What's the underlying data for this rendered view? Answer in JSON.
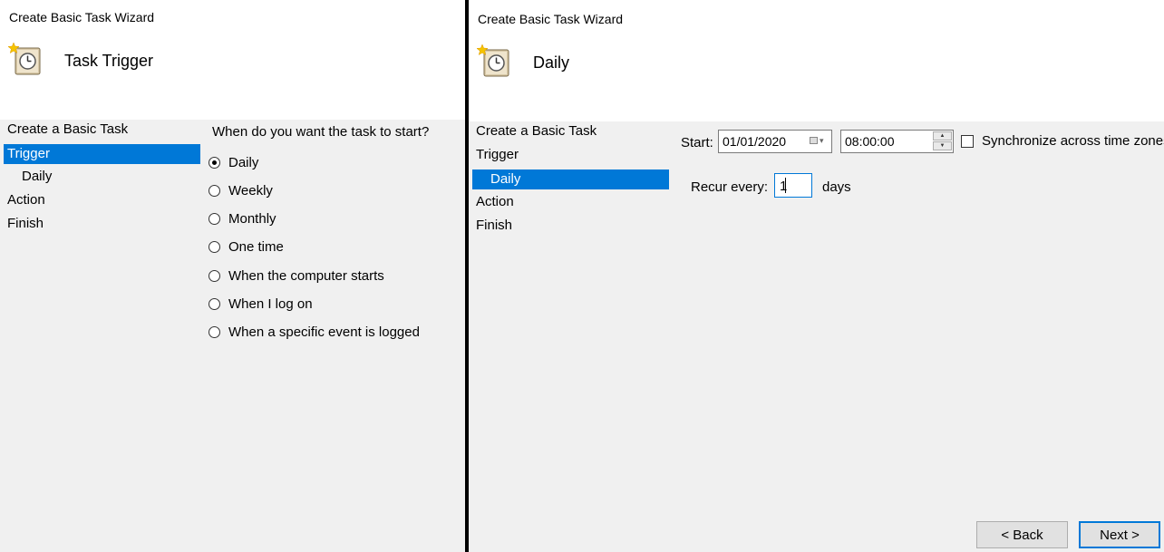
{
  "left_window": {
    "title": "Create Basic Task Wizard",
    "page_title": "Task Trigger",
    "icon": "scheduler-clock-icon",
    "nav": [
      {
        "label": "Create a Basic Task",
        "selected": false
      },
      {
        "label": "Trigger",
        "selected": true
      },
      {
        "label": "Daily",
        "selected": false,
        "sub": true
      },
      {
        "label": "Action",
        "selected": false
      },
      {
        "label": "Finish",
        "selected": false
      }
    ],
    "question": "When do you want the task to start?",
    "options": [
      {
        "label": "Daily",
        "checked": true
      },
      {
        "label": "Weekly",
        "checked": false
      },
      {
        "label": "Monthly",
        "checked": false
      },
      {
        "label": "One time",
        "checked": false
      },
      {
        "label": "When the computer starts",
        "checked": false
      },
      {
        "label": "When I log on",
        "checked": false
      },
      {
        "label": "When a specific event is logged",
        "checked": false
      }
    ]
  },
  "right_window": {
    "title": "Create Basic Task Wizard",
    "page_title": "Daily",
    "icon": "scheduler-clock-icon",
    "nav": [
      {
        "label": "Create a Basic Task",
        "selected": false
      },
      {
        "label": "Trigger",
        "selected": false
      },
      {
        "label": "Daily",
        "selected": true,
        "sub": true
      },
      {
        "label": "Action",
        "selected": false
      },
      {
        "label": "Finish",
        "selected": false
      }
    ],
    "start_label": "Start:",
    "start_date": "01/01/2020",
    "start_time": "08:00:00",
    "sync_label": "Synchronize across time zones",
    "sync_checked": false,
    "recur_label": "Recur every:",
    "recur_value": "1",
    "recur_unit": "days",
    "back_label": "< Back",
    "next_label": "Next >"
  },
  "colors": {
    "selection": "#0078d7",
    "panel_bg": "#f0f0f0",
    "header_bg": "#ffffff"
  }
}
